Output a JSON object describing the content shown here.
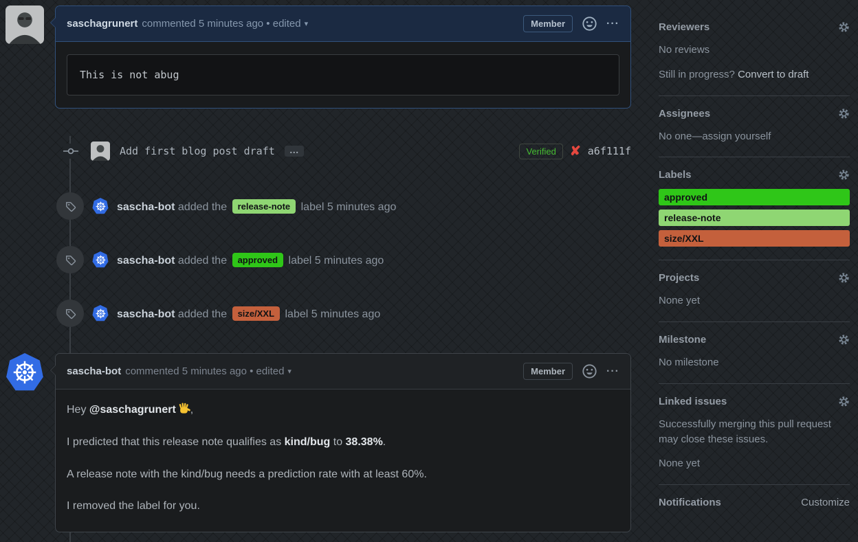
{
  "comment1": {
    "author": "saschagrunert",
    "meta": "commented 5 minutes ago • edited",
    "caret": "▾",
    "badge": "Member",
    "code": "This is not abug"
  },
  "commit": {
    "message": "Add first blog post draft",
    "expand_label": "…",
    "verified_label": "Verified",
    "failure_mark": "✘",
    "sha": "a6f111f"
  },
  "events": [
    {
      "actor": "sascha-bot",
      "action": "added the",
      "label": "release-note",
      "suffix": "label 5 minutes ago",
      "label_color": "#8fd673"
    },
    {
      "actor": "sascha-bot",
      "action": "added the",
      "label": "approved",
      "suffix": "label 5 minutes ago",
      "label_color": "#2fc618"
    },
    {
      "actor": "sascha-bot",
      "action": "added the",
      "label": "size/XXL",
      "suffix": "label 5 minutes ago",
      "label_color": "#c4603c"
    }
  ],
  "comment2": {
    "author": "sascha-bot",
    "meta": "commented 5 minutes ago • edited",
    "caret": "▾",
    "badge": "Member",
    "greeting_pre": "Hey ",
    "mention": "@saschagrunert",
    "greeting_post": ",",
    "p2_a": "I predicted that this release note qualifies as ",
    "p2_bold1": "kind/bug",
    "p2_b": " to ",
    "p2_bold2": "38.38%",
    "p2_c": ".",
    "p3": "A release note with the kind/bug needs a prediction rate with at least 60%.",
    "p4": "I removed the label for you."
  },
  "sidebar": {
    "reviewers": {
      "title": "Reviewers",
      "empty": "No reviews",
      "hint_pre": "Still in progress? ",
      "hint_link": "Convert to draft"
    },
    "assignees": {
      "title": "Assignees",
      "empty_pre": "No one—",
      "self_assign": "assign yourself"
    },
    "labels": {
      "title": "Labels",
      "items": [
        {
          "name": "approved",
          "color": "#2fc618"
        },
        {
          "name": "release-note",
          "color": "#8fd673"
        },
        {
          "name": "size/XXL",
          "color": "#c4603c"
        }
      ]
    },
    "projects": {
      "title": "Projects",
      "empty": "None yet"
    },
    "milestone": {
      "title": "Milestone",
      "empty": "No milestone"
    },
    "linked_issues": {
      "title": "Linked issues",
      "desc": "Successfully merging this pull request may close these issues.",
      "empty": "None yet"
    },
    "notifications": {
      "title": "Notifications",
      "action": "Customize"
    }
  }
}
